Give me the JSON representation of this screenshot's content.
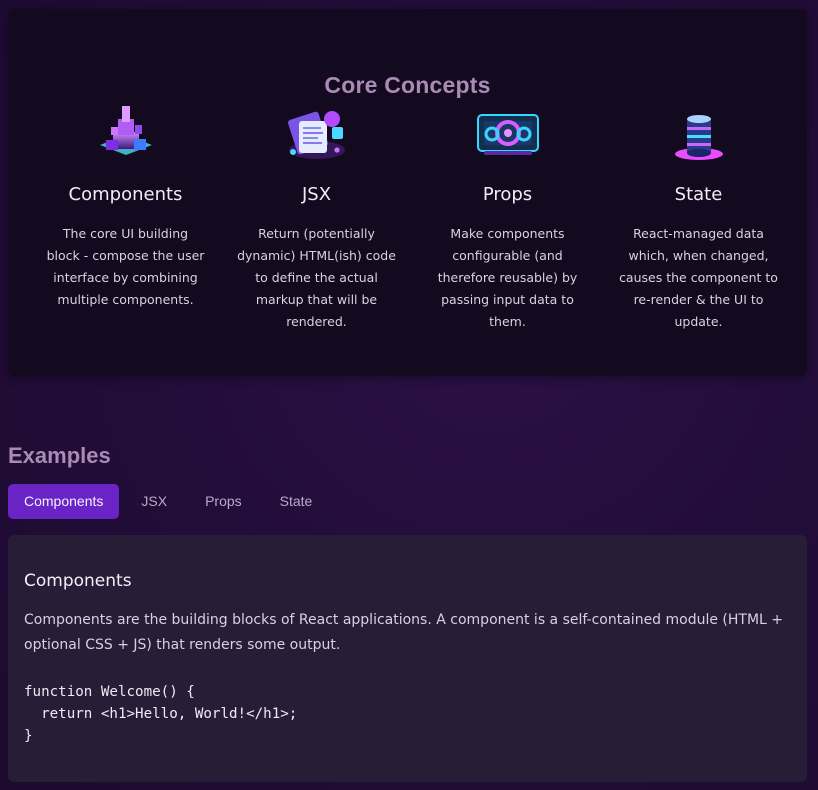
{
  "concepts": {
    "title": "Core Concepts",
    "items": [
      {
        "title": "Components",
        "description": "The core UI building block - compose the user interface by combining multiple components.",
        "icon": "components-icon"
      },
      {
        "title": "JSX",
        "description": "Return (potentially dynamic) HTML(ish) code to define the actual markup that will be rendered.",
        "icon": "jsx-icon"
      },
      {
        "title": "Props",
        "description": "Make components configurable (and therefore reusable) by passing input data to them.",
        "icon": "props-icon"
      },
      {
        "title": "State",
        "description": "React-managed data which, when changed, causes the component to re-render & the UI to update.",
        "icon": "state-icon"
      }
    ]
  },
  "examples": {
    "title": "Examples",
    "tabs": [
      "Components",
      "JSX",
      "Props",
      "State"
    ],
    "active_tab": "Components",
    "content": {
      "heading": "Components",
      "text": "Components are the building blocks of React applications. A component is a self-contained module (HTML + optional CSS + JS) that renders some output.",
      "code": "function Welcome() {\n  return <h1>Hello, World!</h1>;\n}"
    }
  },
  "colors": {
    "accent": "#6a23c5",
    "heading": "#a98bb6",
    "panel": "#140a1f",
    "card": "#271d36"
  }
}
